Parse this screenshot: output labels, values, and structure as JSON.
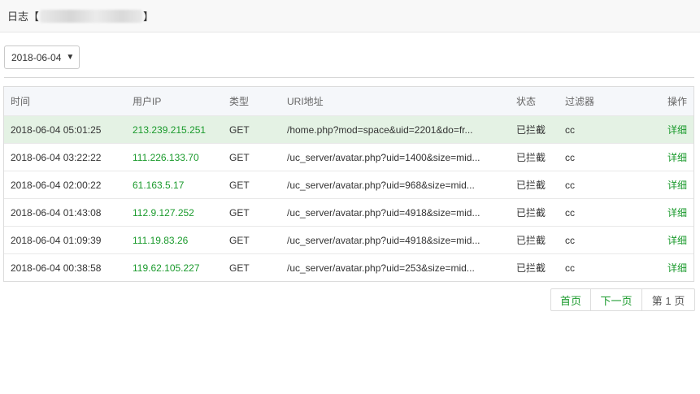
{
  "window": {
    "title_prefix": "日志【",
    "title_suffix": "】"
  },
  "toolbar": {
    "date_value": "2018-06-04",
    "caret": "▼"
  },
  "table": {
    "headers": {
      "time": "时间",
      "ip": "用户IP",
      "type": "类型",
      "uri": "URI地址",
      "status": "状态",
      "filter": "过滤器",
      "action": "操作"
    },
    "rows": [
      {
        "time": "2018-06-04 05:01:25",
        "ip": "213.239.215.251",
        "type": "GET",
        "uri": "/home.php?mod=space&uid=2201&do=fr...",
        "status": "已拦截",
        "filter": "cc",
        "action": "详细"
      },
      {
        "time": "2018-06-04 03:22:22",
        "ip": "111.226.133.70",
        "type": "GET",
        "uri": "/uc_server/avatar.php?uid=1400&size=mid...",
        "status": "已拦截",
        "filter": "cc",
        "action": "详细"
      },
      {
        "time": "2018-06-04 02:00:22",
        "ip": "61.163.5.17",
        "type": "GET",
        "uri": "/uc_server/avatar.php?uid=968&size=mid...",
        "status": "已拦截",
        "filter": "cc",
        "action": "详细"
      },
      {
        "time": "2018-06-04 01:43:08",
        "ip": "112.9.127.252",
        "type": "GET",
        "uri": "/uc_server/avatar.php?uid=4918&size=mid...",
        "status": "已拦截",
        "filter": "cc",
        "action": "详细"
      },
      {
        "time": "2018-06-04 01:09:39",
        "ip": "111.19.83.26",
        "type": "GET",
        "uri": "/uc_server/avatar.php?uid=4918&size=mid...",
        "status": "已拦截",
        "filter": "cc",
        "action": "详细"
      },
      {
        "time": "2018-06-04 00:38:58",
        "ip": "119.62.105.227",
        "type": "GET",
        "uri": "/uc_server/avatar.php?uid=253&size=mid...",
        "status": "已拦截",
        "filter": "cc",
        "action": "详细"
      }
    ]
  },
  "pagination": {
    "first": "首页",
    "next": "下一页",
    "current": "第 1 页"
  },
  "colors": {
    "accent_green": "#1a9a2c",
    "highlight_row": "#e4f2e4"
  }
}
